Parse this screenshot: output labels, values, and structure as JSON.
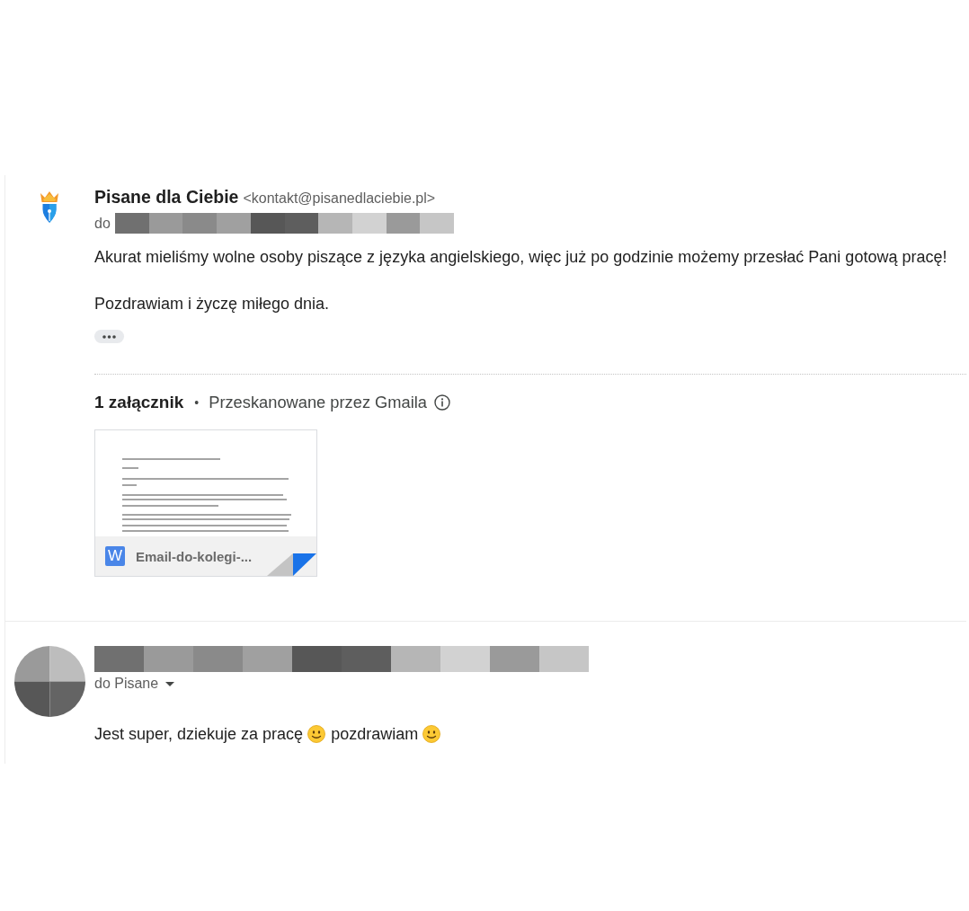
{
  "messages": [
    {
      "avatar": {
        "kind": "logo"
      },
      "sender": {
        "kind": "named",
        "name": "Pisane dla Ciebie",
        "email": "<kontakt@pisanedlaciebie.pl>"
      },
      "recipient": {
        "kind": "redacted",
        "prefix": "do"
      },
      "body": [
        [
          {
            "kind": "text",
            "text": "Akurat mieliśmy wolne osoby piszące z języka angielskiego, więc już po godzinie możemy przesłać Pani gotową pracę!"
          }
        ],
        [
          {
            "kind": "text",
            "text": "Pozdrawiam i życzę miłego dnia."
          }
        ]
      ],
      "trimmed_content": true,
      "attachments_header": {
        "count": "1 załącznik",
        "separator": "•",
        "scan_note": "Przeskanowane przez Gmaila"
      },
      "attachments": [
        {
          "badge": "W",
          "filename": "Email-do-kolegi-..."
        }
      ]
    },
    {
      "avatar": {
        "kind": "pixelated"
      },
      "sender": {
        "kind": "redacted"
      },
      "recipient": {
        "kind": "toggle",
        "label": "do Pisane",
        "expanded": false
      },
      "body": [
        [
          {
            "kind": "text",
            "text": "Jest super, dziekuje za pracę"
          },
          {
            "kind": "smiley"
          },
          {
            "kind": "text",
            "text": "pozdrawiam"
          },
          {
            "kind": "smiley"
          }
        ]
      ]
    }
  ]
}
